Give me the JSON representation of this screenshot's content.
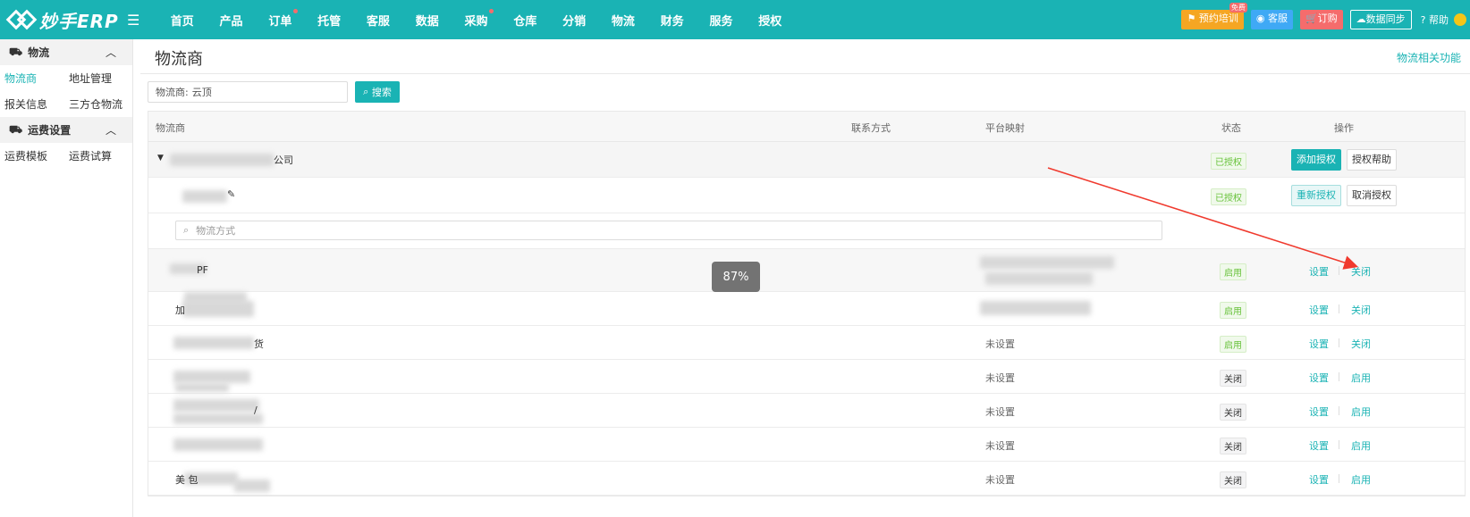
{
  "app": {
    "name": "妙手ERP"
  },
  "nav": [
    {
      "label": "首页",
      "dot": false
    },
    {
      "label": "产品",
      "dot": false
    },
    {
      "label": "订单",
      "dot": true
    },
    {
      "label": "托管",
      "dot": false
    },
    {
      "label": "客服",
      "dot": false
    },
    {
      "label": "数据",
      "dot": false
    },
    {
      "label": "采购",
      "dot": true
    },
    {
      "label": "仓库",
      "dot": false
    },
    {
      "label": "分销",
      "dot": false
    },
    {
      "label": "物流",
      "dot": false
    },
    {
      "label": "财务",
      "dot": false
    },
    {
      "label": "服务",
      "dot": false
    },
    {
      "label": "授权",
      "dot": false
    }
  ],
  "topRight": {
    "training": "预约培训",
    "trainingBadge": "免费",
    "service": "客服",
    "buy": "订购",
    "sync": "数据同步",
    "help": "帮助"
  },
  "sidebar": {
    "groups": [
      {
        "title": "物流",
        "items": [
          [
            "物流商",
            "地址管理"
          ],
          [
            "报关信息",
            "三方仓物流"
          ]
        ]
      },
      {
        "title": "运费设置",
        "items": [
          [
            "运费模板",
            "运费试算"
          ]
        ]
      }
    ]
  },
  "page": {
    "title": "物流商",
    "rightLink": "物流相关功能",
    "search": {
      "label": "物流商:",
      "value": "云顶",
      "button": "搜索"
    },
    "columns": [
      "物流商",
      "联系方式",
      "平台映射",
      "状态",
      "操作"
    ],
    "provider": {
      "nameSuffix": "公司",
      "status": "已授权",
      "addAuth": "添加授权",
      "authHelp": "授权帮助"
    },
    "account": {
      "status": "已授权",
      "reauth": "重新授权",
      "cancelAuth": "取消授权"
    },
    "methodSearchPlaceholder": "物流方式",
    "methods": [
      {
        "nameVisible": "PF",
        "mapping": "",
        "status": "启用",
        "op2": "关闭"
      },
      {
        "nameVisible": "加",
        "mapping": "",
        "status": "启用",
        "op2": "关闭"
      },
      {
        "nameVisible": "货",
        "mapping": "未设置",
        "status": "启用",
        "op2": "关闭"
      },
      {
        "nameVisible": "",
        "mapping": "未设置",
        "status": "关闭",
        "op2": "启用"
      },
      {
        "nameVisible": "/",
        "mapping": "未设置",
        "status": "关闭",
        "op2": "启用"
      },
      {
        "nameVisible": "",
        "mapping": "未设置",
        "status": "关闭",
        "op2": "启用"
      },
      {
        "nameVisible": "美 包",
        "mapping": "未设置",
        "status": "关闭",
        "op2": "启用"
      }
    ],
    "opSet": "设置"
  },
  "overlay": {
    "progress": "87%"
  },
  "colors": {
    "primary": "#1ab3b4",
    "green": "#67c23a",
    "red": "#f56c6c"
  }
}
